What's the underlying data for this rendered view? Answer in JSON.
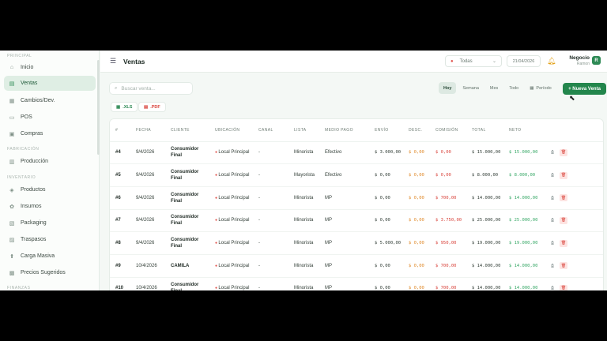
{
  "sidebar": {
    "sections": {
      "principal": "PRINCIPAL",
      "fabricacion": "FABRICACIÓN",
      "inventario": "INVENTARIO",
      "finanzas": "FINANZAS"
    },
    "items": [
      {
        "label": "Inicio",
        "icon": "home-icon"
      },
      {
        "label": "Ventas",
        "icon": "sales-icon",
        "active": true
      },
      {
        "label": "Cambios/Dev.",
        "icon": "exchange-icon"
      },
      {
        "label": "POS",
        "icon": "pos-icon"
      },
      {
        "label": "Compras",
        "icon": "cart-icon"
      },
      {
        "label": "Producción",
        "icon": "factory-icon"
      },
      {
        "label": "Productos",
        "icon": "box-icon"
      },
      {
        "label": "Insumos",
        "icon": "supplies-icon"
      },
      {
        "label": "Packaging",
        "icon": "package-icon"
      },
      {
        "label": "Traspasos",
        "icon": "transfer-icon"
      },
      {
        "label": "Carga Masiva",
        "icon": "upload-icon"
      },
      {
        "label": "Precios Sugeridos",
        "icon": "price-tag-icon"
      }
    ]
  },
  "header": {
    "title": "Ventas",
    "location": "Todas",
    "date": "21/04/2026",
    "business_name": "Negocio",
    "business_sub": "Ramon",
    "avatar_letter": "R"
  },
  "toolbar": {
    "search_placeholder": "Buscar venta...",
    "filters": [
      "Hoy",
      "Semana",
      "Mes",
      "Todo",
      "Período"
    ],
    "active_filter": "Hoy",
    "new_sale": "+ Nueva Venta",
    "export_xls": ".XLS",
    "export_pdf": ".PDF"
  },
  "table": {
    "columns": [
      "#",
      "FECHA",
      "CLIENTE",
      "UBICACIÓN",
      "CANAL",
      "LISTA",
      "MEDIO PAGO",
      "ENVÍO",
      "DESC.",
      "COMISIÓN",
      "TOTAL",
      "NETO"
    ],
    "rows": [
      {
        "id": "#4",
        "fecha": "9/4/2026",
        "cliente": "Consumidor Final",
        "ubicacion": "Local Principal",
        "canal": "-",
        "lista": "Minorista",
        "pago": "Efectivo",
        "envio": "$ 3.000,00",
        "desc": "$ 0,00",
        "comision": "$ 0,00",
        "total": "$ 15.000,00",
        "neto": "$ 15.000,00"
      },
      {
        "id": "#5",
        "fecha": "9/4/2026",
        "cliente": "Consumidor Final",
        "ubicacion": "Local Principal",
        "canal": "-",
        "lista": "Mayorista",
        "pago": "Efectivo",
        "envio": "$ 0,00",
        "desc": "$ 0,00",
        "comision": "$ 0,00",
        "total": "$ 8.000,00",
        "neto": "$ 8.000,00"
      },
      {
        "id": "#6",
        "fecha": "9/4/2026",
        "cliente": "Consumidor Final",
        "ubicacion": "Local Principal",
        "canal": "-",
        "lista": "Minorista",
        "pago": "MP",
        "envio": "$ 0,00",
        "desc": "$ 0,00",
        "comision": "$ 700,00",
        "total": "$ 14.000,00",
        "neto": "$ 14.000,00"
      },
      {
        "id": "#7",
        "fecha": "9/4/2026",
        "cliente": "Consumidor Final",
        "ubicacion": "Local Principal",
        "canal": "-",
        "lista": "Minorista",
        "pago": "MP",
        "envio": "$ 0,00",
        "desc": "$ 0,00",
        "comision": "$ 3.750,00",
        "total": "$ 25.000,00",
        "neto": "$ 25.000,00"
      },
      {
        "id": "#8",
        "fecha": "9/4/2026",
        "cliente": "Consumidor Final",
        "ubicacion": "Local Principal",
        "canal": "-",
        "lista": "Minorista",
        "pago": "MP",
        "envio": "$ 5.000,00",
        "desc": "$ 0,00",
        "comision": "$ 950,00",
        "total": "$ 19.000,00",
        "neto": "$ 19.000,00"
      },
      {
        "id": "#9",
        "fecha": "10/4/2026",
        "cliente": "CAMILA",
        "ubicacion": "Local Principal",
        "canal": "-",
        "lista": "Minorista",
        "pago": "MP",
        "envio": "$ 0,00",
        "desc": "$ 0,00",
        "comision": "$ 700,00",
        "total": "$ 14.000,00",
        "neto": "$ 14.000,00"
      },
      {
        "id": "#10",
        "fecha": "10/4/2026",
        "cliente": "Consumidor Final",
        "ubicacion": "Local Principal",
        "canal": "-",
        "lista": "Minorista",
        "pago": "MP",
        "envio": "$ 0,00",
        "desc": "$ 0,00",
        "comision": "$ 700,00",
        "total": "$ 14.000,00",
        "neto": "$ 14.000,00"
      }
    ]
  }
}
